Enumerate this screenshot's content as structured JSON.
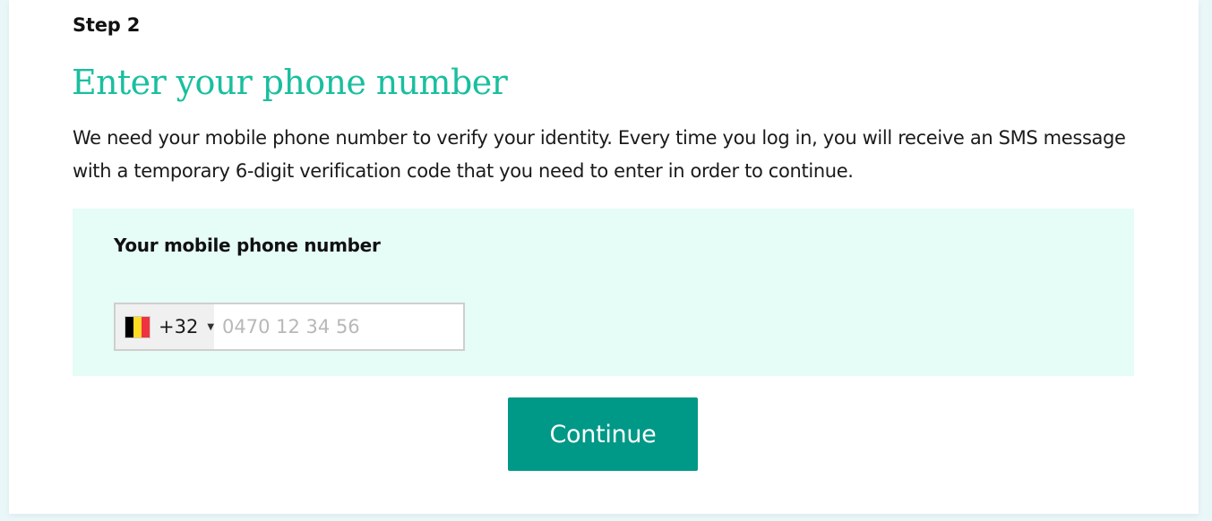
{
  "step": {
    "label": "Step 2"
  },
  "page": {
    "title": "Enter your phone number",
    "description": "We need your mobile phone number to verify your identity. Every time you log in, you will receive an SMS message with a temporary 6-digit verification code that you need to enter in order to continue."
  },
  "phone_field": {
    "label": "Your mobile phone number",
    "country": {
      "dial_code": "+32",
      "flag": "belgium-flag-icon",
      "flag_colors": [
        "#000000",
        "#fdda24",
        "#ef3340"
      ]
    },
    "value": "",
    "placeholder": "0470 12 34 56"
  },
  "actions": {
    "continue_label": "Continue"
  },
  "colors": {
    "title": "#19bf9f",
    "panel_background": "#e6fcf6",
    "button": "#009886",
    "page_background": "#e9f7f9"
  }
}
